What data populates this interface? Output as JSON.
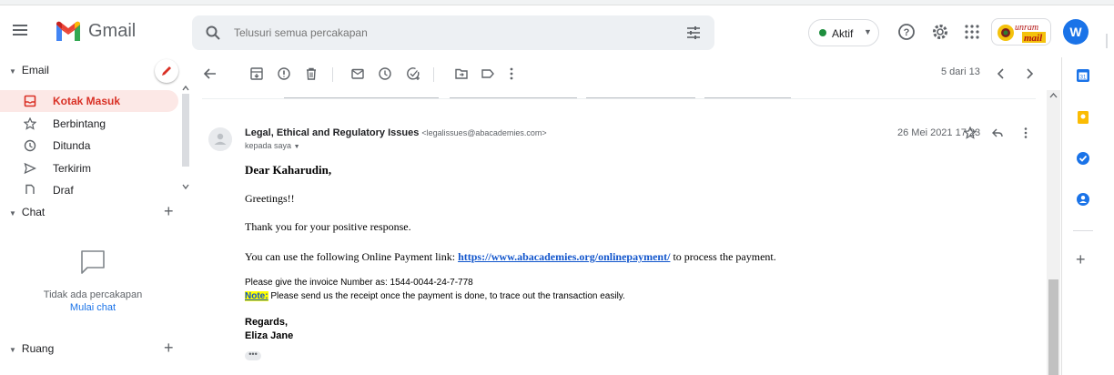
{
  "app": {
    "name": "Gmail"
  },
  "search": {
    "placeholder": "Telusuri semua percakapan"
  },
  "status": {
    "label": "Aktif",
    "color": "#1e8e3e"
  },
  "header_org_badge": {
    "text": "unram",
    "subtext": "mail"
  },
  "user": {
    "initial": "W"
  },
  "nav": {
    "email_section": "Email",
    "items": [
      {
        "label": "Kotak Masuk",
        "icon": "inbox-icon",
        "active": true
      },
      {
        "label": "Berbintang",
        "icon": "star-icon"
      },
      {
        "label": "Ditunda",
        "icon": "clock-icon"
      },
      {
        "label": "Terkirim",
        "icon": "send-icon"
      },
      {
        "label": "Draf",
        "icon": "draft-icon"
      }
    ],
    "chat_section": "Chat",
    "chat_empty": "Tidak ada percakapan",
    "chat_start": "Mulai chat",
    "rooms_section": "Ruang"
  },
  "pager": {
    "text": "5 dari 13"
  },
  "message": {
    "sender_name": "Legal, Ethical and Regulatory Issues",
    "sender_email": "<legalissues@abacademies.com>",
    "to": "kepada saya",
    "date": "26 Mei 2021 17.23",
    "greeting": "Dear Kaharudin,",
    "line1": "Greetings!!",
    "line2": "Thank you for your positive response.",
    "line3_pre": "You can use the following Online Payment link: ",
    "line3_link": "https://www.abacademies.org/onlinepayment/",
    "line3_post": " to process the payment.",
    "invoice": "Please give the invoice Number as: 1544-0044-24-7-778",
    "note_label": "Note:",
    "note_text": " Please send us the receipt once the payment is done, to trace out the transaction easily.",
    "regards": "Regards,",
    "signature": "Eliza Jane",
    "ellipsis": "•••"
  }
}
